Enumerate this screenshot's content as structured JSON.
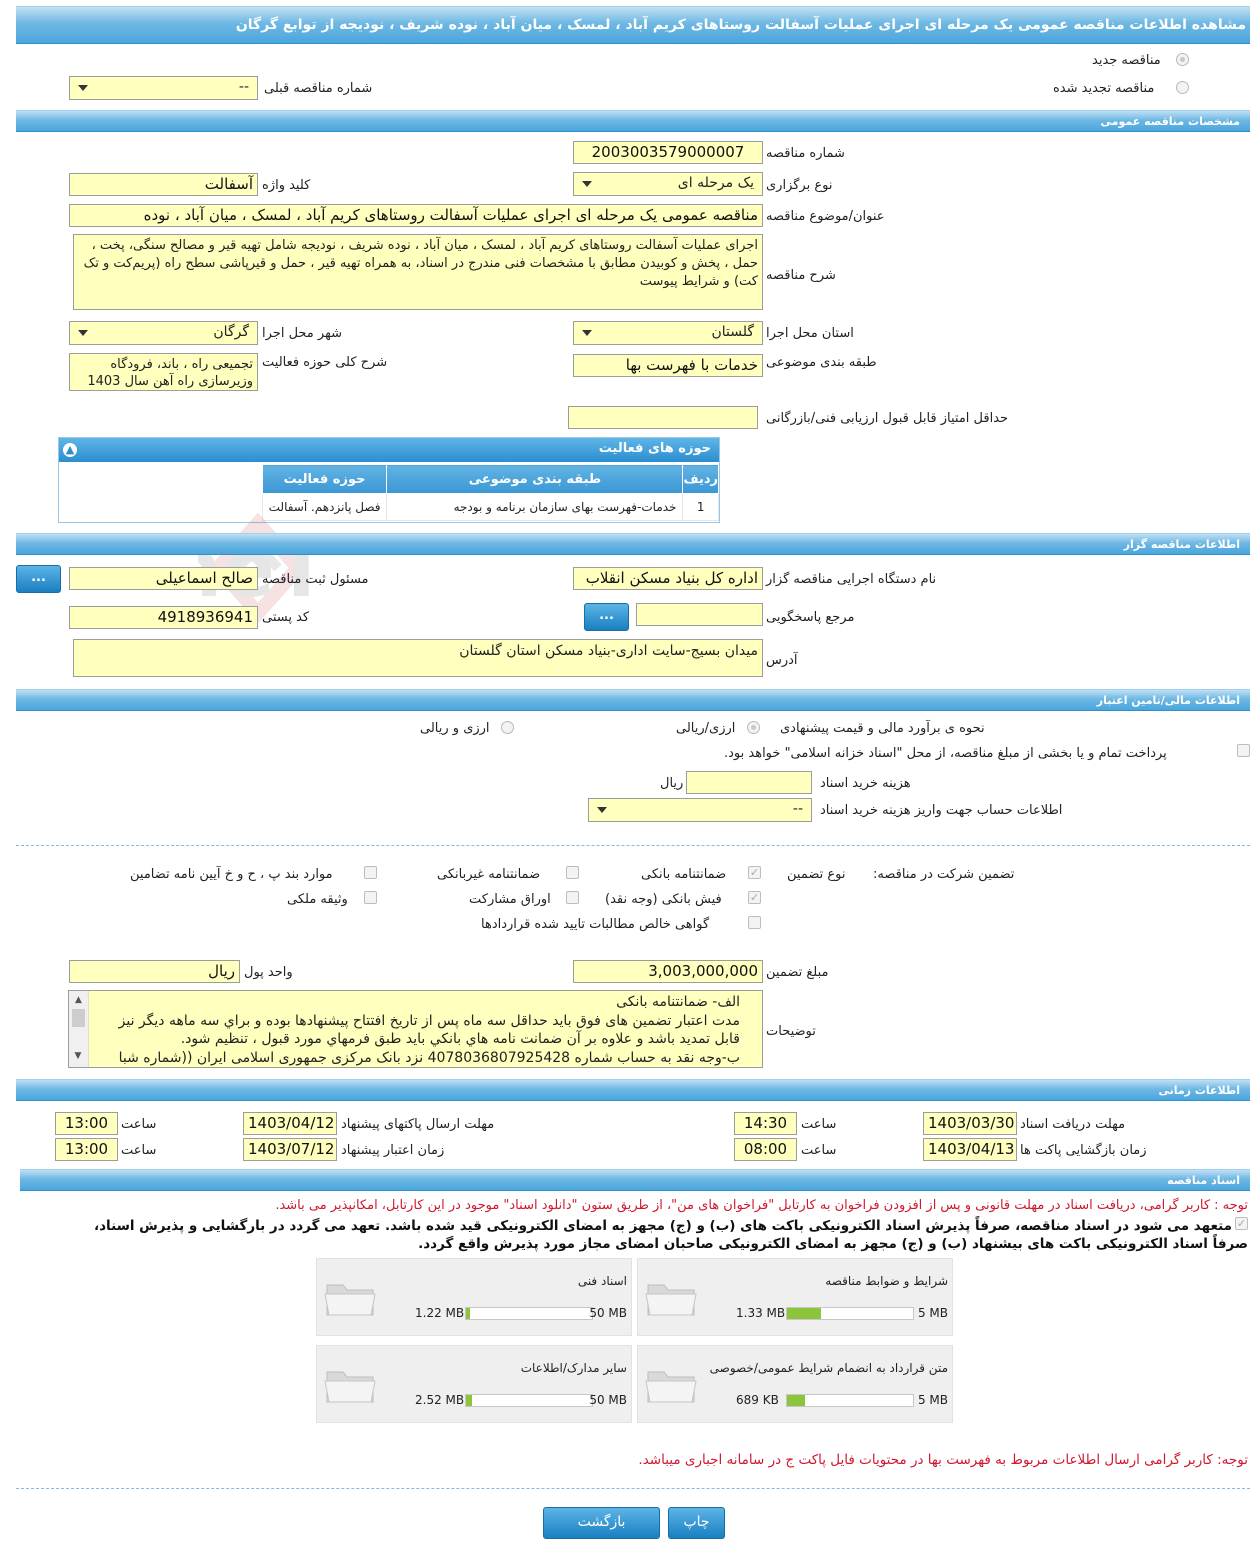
{
  "title": "مشاهده اطلاعات مناقصه عمومی یک مرحله ای اجرای عملیات آسفالت روستاهای کریم آباد ، لمسک ، میان آباد ، نوده شریف ، نودیجه از توابع گرگان",
  "top": {
    "new_tender": "مناقصه جدید",
    "renewed_tender": "مناقصه تجدید شده",
    "prev_number_label": "شماره مناقصه قبلی",
    "prev_number_value": "--"
  },
  "general": {
    "header": "مشخصات مناقصه عمومی",
    "number_label": "شماره مناقصه",
    "number_value": "2003003579000007",
    "type_label": "نوع برگزاری",
    "type_value": "یک مرحله ای",
    "keyword_label": "کلید واژه",
    "keyword_value": "آسفالت",
    "subject_label": "عنوان/موضوع مناقصه",
    "subject_value": "مناقصه عمومی یک مرحله ای اجرای عملیات آسفالت روستاهای کریم آباد ، لمسک ، میان آباد ، نوده",
    "desc_label": "شرح مناقصه",
    "desc_value": "اجرای عملیات آسفالت روستاهای کریم آباد ، لمسک ، میان آباد ، نوده شریف ، نودیجه شامل تهیه قیر و مصالح سنگی، پخت ، حمل ، پخش و کوبیدن مطابق با مشخصات فنی مندرج در اسناد، به همراه تهیه قیر ، حمل و قیرپاشی سطح راه (پریم‌کت و تک کت) و شرایط پیوست",
    "province_label": "استان محل اجرا",
    "province_value": "گلستان",
    "city_label": "شهر محل اجرا",
    "city_value": "گرگان",
    "category_label": "طبقه بندی موضوعی",
    "category_value": "خدمات با فهرست بها",
    "scope_label": "شرح کلی حوزه فعالیت",
    "scope_value": "تجمیعی راه ، باند، فرودگاه وزیرسازی راه آهن سال 1403",
    "min_score_label": "حداقل امتیاز قابل قبول ارزیابی فنی/بازرگانی",
    "min_score_value": ""
  },
  "activity": {
    "title": "حوزه های فعالیت",
    "columns": [
      "ردیف",
      "طبقه بندی موضوعی",
      "حوزه فعالیت"
    ],
    "rows": [
      [
        "1",
        "خدمات-فهرست بهای سازمان برنامه و بودجه",
        "فصل پانزدهم. آسفالت"
      ]
    ]
  },
  "org": {
    "header": "اطلاعات مناقصه گزار",
    "name_label": "نام دستگاه اجرایی مناقصه گزار",
    "name_value": "اداره کل بنیاد مسکن انقلاب",
    "resp_label": "مسئول ثبت مناقصه",
    "resp_value": "صالح اسماعیلی",
    "ref_label": "مرجع پاسخگویی",
    "ref_value": "",
    "postal_label": "کد پستی",
    "postal_value": "4918936941",
    "address_label": "آدرس",
    "address_value": "میدان بسیج-سایت اداری-بنیاد مسکن استان گلستان",
    "more_btn": "..."
  },
  "finance": {
    "header": "اطلاعات مالی/تامین اعتبار",
    "estimate_label": "نحوه ی برآورد مالی و قیمت پیشنهادی",
    "opt_rial": "ارزی/ریالی",
    "opt_both": "ارزی و ریالی",
    "treasury_text": "پرداخت تمام و یا بخشی از مبلغ مناقصه، از محل \"اسناد خزانه اسلامی\" خواهد بود.",
    "doc_cost_label": "هزینه خرید اسناد",
    "doc_cost_unit": "ریال",
    "account_label": "اطلاعات حساب جهت واریز هزینه خرید اسناد",
    "account_value": "--"
  },
  "guarantee": {
    "label": "تضمین شرکت در مناقصه:",
    "type_label": "نوع تضمین",
    "items": {
      "bank": "ضمانتنامه بانکی",
      "nonbank": "ضمانتنامه غیربانکی",
      "regulation": "موارد بند پ ، ح و خ آیین نامه تضامین",
      "cash": "فیش بانکی (وجه نقد)",
      "bonds": "اوراق مشارکت",
      "property": "وثیقه ملکی",
      "claims": "گواهی خالص مطالبات تایید شده قراردادها"
    },
    "amount_label": "مبلغ تضمین",
    "amount_value": "3,003,000,000",
    "currency_label": "واحد پول",
    "currency_value": "ریال",
    "notes_label": "توضیحات",
    "notes_lines": [
      "الف- ضمانتنامه بانکی",
      "مدت اعتبار تضمین های فوق باید حداقل سه ماه پس از تاریخ افتتاح پیشنهادها بوده و براي سه ماهه ديگر نيز",
      "قابل تمديد باشد و علاوه بر آن ضمانت نامه هاي بانکي بايد طبق فرمهاي مورد قبول ، تنظيم شود.",
      "ب-وجه نقد به حساب شماره 4078036807925428 نزد بانک مرکزی جمهوری اسلامی ایران ((شماره شبا"
    ]
  },
  "time": {
    "header": "اطلاعات زمانی",
    "doc_receive_label": "مهلت دریافت اسناد",
    "doc_receive_date": "1403/03/30",
    "doc_receive_time": "14:30",
    "send_label": "مهلت ارسال پاکتهای پیشنهاد",
    "send_date": "1403/04/12",
    "send_time": "13:00",
    "open_label": "زمان بازگشایی پاکت ها",
    "open_date": "1403/04/13",
    "open_time": "08:00",
    "valid_label": "زمان اعتبار پیشنهاد",
    "valid_date": "1403/07/12",
    "valid_time": "13:00",
    "time_word": "ساعت"
  },
  "docs": {
    "header": "اسناد مناقصه",
    "notice": "توجه : کاربر گرامی، دریافت اسناد در مهلت قانونی و پس از افزودن فراخوان به کارتابل \"فراخوان های من\"، از طریق ستون \"دانلود اسناد\" موجود در این کارتابل، امکانپذیر می باشد.",
    "commit_line1": "متعهد می شود در اسناد مناقصه، صرفاً پذیرش اسناد الکترونیکی باکت های (ب) و (ج) مجهز به امضای الکترونیکی قید شده باشد. تعهد می گردد در بارگشایی و پذیرش اسناد،",
    "commit_line2": "صرفاً اسناد الکترونیکی باکت های بیشنهاد (ب) و (ج) مجهز به امضای الکترونیکی صاحبان امضای مجاز مورد پذیرش واقع گردد.",
    "files": [
      {
        "name": "شرایط و ضوابط مناقصه",
        "size": "1.33 MB",
        "max": "5 MB",
        "fill": 0.27
      },
      {
        "name": "اسناد فنی",
        "size": "1.22 MB",
        "max": "50 MB",
        "fill": 0.03
      },
      {
        "name": "متن قرارداد به انضمام شرایط عمومی/خصوصی",
        "size": "689 KB",
        "max": "5 MB",
        "fill": 0.14
      },
      {
        "name": "سایر مدارک/اطلاعات",
        "size": "2.52 MB",
        "max": "50 MB",
        "fill": 0.05
      }
    ],
    "footer_notice": "توجه: کاربر گرامی ارسال اطلاعات مربوط به فهرست بها در محتویات فایل پاکت ج در سامانه اجباری میباشد."
  },
  "buttons": {
    "print": "چاپ",
    "back": "بازگشت"
  },
  "watermark": "AriaTender.neT",
  "colors": {
    "accent": "#4aa6dd",
    "field": "#ffffbe",
    "warn": "#d0182e"
  }
}
